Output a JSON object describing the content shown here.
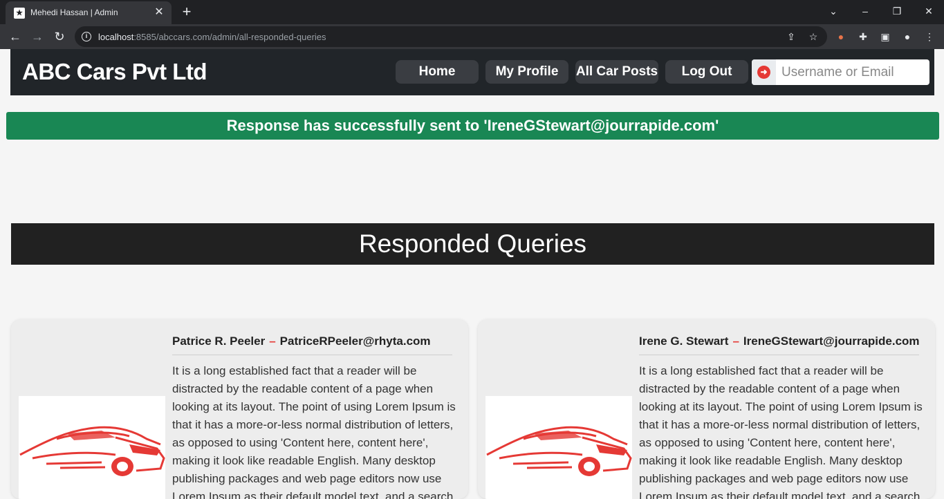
{
  "browser": {
    "tab_title": "Mehedi Hassan | Admin",
    "url_host": "localhost",
    "url_rest": ":8585/abccars.com/admin/all-responded-queries"
  },
  "site": {
    "brand": "ABC Cars Pvt Ltd",
    "nav": [
      "Home",
      "My Profile",
      "All Car Posts",
      "Log Out"
    ],
    "search_placeholder": "Username or Email"
  },
  "alert": {
    "message": "Response has successfully sent to 'IreneGStewart@jourrapide.com'"
  },
  "section_title": "Responded Queries",
  "queries": [
    {
      "name": "Patrice R. Peeler",
      "email": "PatriceRPeeler@rhyta.com",
      "message": "It is a long established fact that a reader will be distracted by the readable content of a page when looking at its layout. The point of using Lorem Ipsum is that it has a more-or-less normal distribution of letters, as opposed to using 'Content here, content here', making it look like readable English. Many desktop publishing packages and web page editors now use Lorem Ipsum as their default model text, and a search for 'lorem ipsum' will"
    },
    {
      "name": "Irene G. Stewart",
      "email": "IreneGStewart@jourrapide.com",
      "message": "It is a long established fact that a reader will be distracted by the readable content of a page when looking at its layout. The point of using Lorem Ipsum is that it has a more-or-less normal distribution of letters, as opposed to using 'Content here, content here', making it look like readable English. Many desktop publishing packages and web page editors now use Lorem Ipsum as their default model text, and a search for 'lorem ipsum' will"
    }
  ],
  "colors": {
    "accent_red": "#e53935",
    "success_green": "#198754",
    "header_dark": "#212529"
  }
}
